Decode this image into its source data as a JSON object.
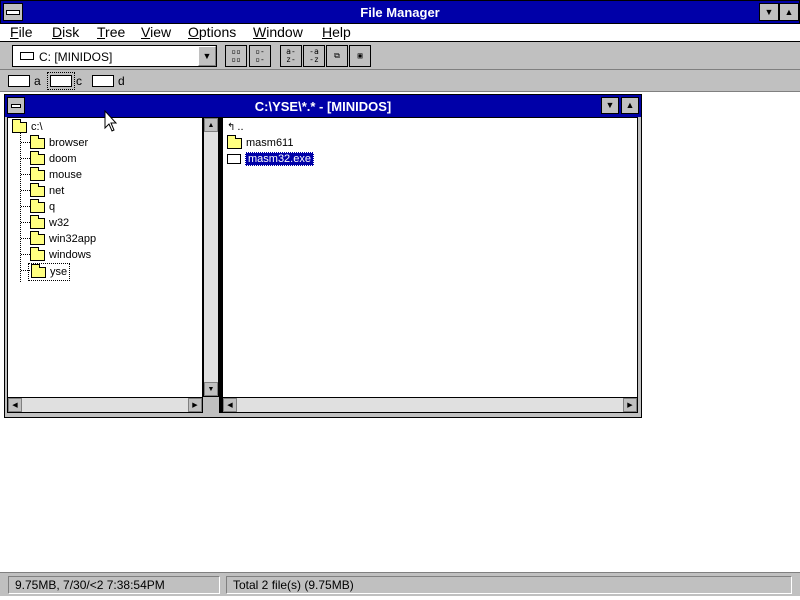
{
  "window": {
    "title": "File Manager"
  },
  "menubar": {
    "items": [
      "File",
      "Disk",
      "Tree",
      "View",
      "Options",
      "Window",
      "Help"
    ]
  },
  "toolbar": {
    "drive_combo_value": "C: [MINIDOS]"
  },
  "drivebar": {
    "drives": [
      {
        "letter": "a"
      },
      {
        "letter": "c"
      },
      {
        "letter": "d"
      }
    ]
  },
  "child_window": {
    "title": "C:\\YSE\\*.* - [MINIDOS]",
    "tree": {
      "root": "c:\\",
      "items": [
        "browser",
        "doom",
        "mouse",
        "net",
        "q",
        "w32",
        "win32app",
        "windows",
        "yse"
      ],
      "selected": "yse"
    },
    "files": {
      "up_label": "..",
      "items": [
        {
          "name": "masm611",
          "type": "folder"
        },
        {
          "name": "masm32.exe",
          "type": "file",
          "selected": true
        }
      ]
    }
  },
  "status": {
    "left": "9.75MB, 7/30/<2 7:38:54PM",
    "right": "Total 2 file(s) (9.75MB)"
  }
}
